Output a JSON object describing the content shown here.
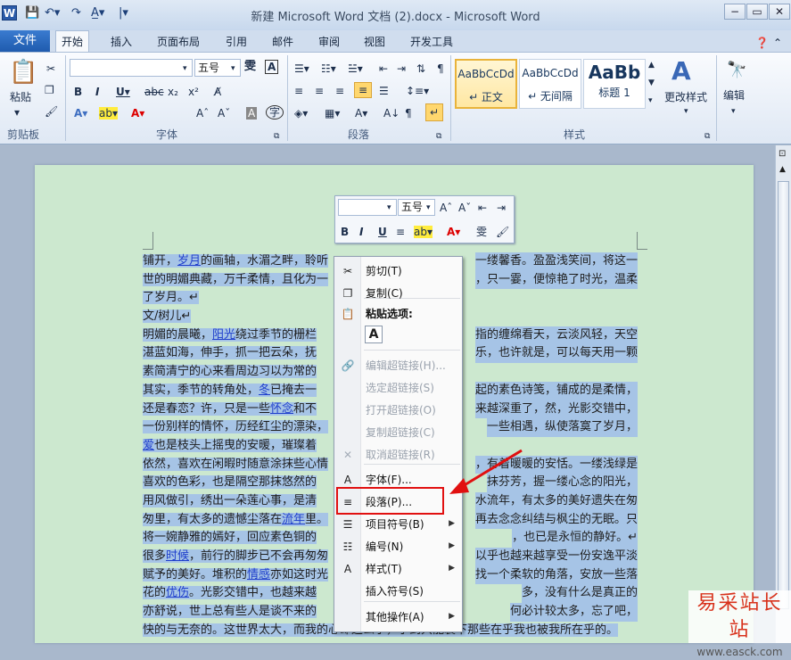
{
  "window": {
    "title": "新建 Microsoft Word 文档 (2).docx  -  Microsoft Word",
    "app_icon": "W",
    "controls": [
      "−",
      "▭",
      "✕"
    ]
  },
  "tabs": [
    "文件",
    "开始",
    "插入",
    "页面布局",
    "引用",
    "邮件",
    "审阅",
    "视图",
    "开发工具"
  ],
  "ribbon": {
    "clipboard": {
      "paste_label": "粘贴",
      "group": "剪贴板"
    },
    "font": {
      "name_value": "",
      "size_value": "五号",
      "group": "字体"
    },
    "paragraph": {
      "group": "段落"
    },
    "styles": {
      "group": "样式",
      "items": [
        {
          "preview": "AaBbCcDd",
          "name": "↵ 正文"
        },
        {
          "preview": "AaBbCcDd",
          "name": "↵ 无间隔"
        },
        {
          "preview": "AaBb",
          "name": "标题 1"
        }
      ],
      "change_label": "更改样式"
    },
    "editing": {
      "label": "编辑"
    }
  },
  "minitoolbar": {
    "font_value": "",
    "size_value": "五号"
  },
  "document": {
    "lines": [
      [
        "铺开，",
        {
          "link": "岁月"
        },
        "的画轴，水湄之畔，聆听"
      ],
      [
        "世的明媚典藏，万千柔情，且化为一"
      ],
      [
        "了岁月。↵"
      ],
      [
        "文/树儿↵"
      ],
      [
        "明媚的晨曦，",
        {
          "link": "阳光"
        },
        "绕过季节的栅栏"
      ],
      [
        "湛蓝如海，伸手，抓一把云朵，抚"
      ],
      [
        "素简清宁的心来看周边习以为常的"
      ],
      [
        "其实，季节的转角处，",
        {
          "link": "冬"
        },
        "已掩去一"
      ],
      [
        "还是春恋？许，只是一些",
        {
          "link": "怀念"
        },
        "和不"
      ],
      [
        "一份别样的情怀，历经红尘的漂染，"
      ],
      [
        {
          "link": "爱"
        },
        "也是枝头上摇曳的安暖，璀璨着"
      ],
      [
        "依然，喜欢在闲暇时随意涂抹些心情"
      ],
      [
        "喜欢的色彩，也是隔空那抹悠然的"
      ],
      [
        "用风做引，绣出一朵莲心事，是清"
      ],
      [
        "匆里，有太多的遗憾尘落在",
        {
          "link": "流年"
        },
        "里。"
      ],
      [
        "将一婉静雅的嫣好，回应素色铜的"
      ],
      [
        "很多",
        {
          "link": "时候"
        },
        "，前行的脚步已不会再匆匆"
      ],
      [
        "赋予的美好。堆积的",
        {
          "link": "情感"
        },
        "亦如这时光"
      ],
      [
        "花的",
        {
          "link": "优伤"
        },
        "。光影交错中，也越来越"
      ],
      [
        "亦舒说，世上总有些人是谈不来的"
      ],
      [
        "快的与无奈的。这世界太大，而我的心却这么小，小到只能装下那些在乎我也被我所在乎的。"
      ]
    ],
    "right_lines": [
      "一缕馨香。盈盈浅笑间，将这一",
      "，只一霎，便惊艳了时光，温柔",
      "",
      "",
      "指的缠绵看天，云淡风轻，天空",
      "乐，也许就是，可以每天用一颗",
      "",
      "起的素色诗笺，铺成的是柔情，",
      "来越深重了，然，光影交错中，",
      "一些相遇，纵使落寞了岁月，",
      "",
      "，有着暖暖的安恬。一缕浅绿是",
      "抹芬芳，握一缕心念的阳光，",
      "水流年，有太多的美好遗失在匆",
      "再去念念纠结与枫尘的无眠。只",
      "，也已是永恒的静好。↵",
      "以乎也越来越享受一份安逸平淡",
      "找一个柔软的角落，安放一些落",
      "多，没有什么是真正的",
      "何必计较太多，忘了吧，",
      ""
    ]
  },
  "context_menu": {
    "items": [
      {
        "icon": "scissors-icon",
        "glyph": "✂",
        "label": "剪切(T)",
        "enabled": true
      },
      {
        "icon": "copy-icon",
        "glyph": "❐",
        "label": "复制(C)",
        "enabled": true
      },
      {
        "icon": "paste-icon",
        "glyph": "📋",
        "label": "粘贴选项:",
        "enabled": true,
        "bold": true
      },
      {
        "icon": "keep-text-only-icon",
        "glyph": "A",
        "label": "",
        "enabled": true
      },
      {
        "icon": "edit-hyperlink-icon",
        "glyph": "🔗",
        "label": "编辑超链接(H)...",
        "enabled": false
      },
      {
        "icon": "",
        "glyph": "",
        "label": "选定超链接(S)",
        "enabled": false
      },
      {
        "icon": "",
        "glyph": "",
        "label": "打开超链接(O)",
        "enabled": false
      },
      {
        "icon": "",
        "glyph": "",
        "label": "复制超链接(C)",
        "enabled": false
      },
      {
        "icon": "remove-hyperlink-icon",
        "glyph": "✕",
        "label": "取消超链接(R)",
        "enabled": false
      },
      {
        "icon": "font-icon",
        "glyph": "A",
        "label": "字体(F)...",
        "enabled": true
      },
      {
        "icon": "paragraph-icon",
        "glyph": "≡",
        "label": "段落(P)...",
        "enabled": true
      },
      {
        "icon": "bullets-icon",
        "glyph": "☰",
        "label": "项目符号(B)",
        "enabled": true,
        "submenu": true
      },
      {
        "icon": "numbering-icon",
        "glyph": "☷",
        "label": "编号(N)",
        "enabled": true,
        "submenu": true
      },
      {
        "icon": "styles-icon",
        "glyph": "A",
        "label": "样式(T)",
        "enabled": true,
        "submenu": true
      },
      {
        "icon": "",
        "glyph": "",
        "label": "插入符号(S)",
        "enabled": true
      },
      {
        "icon": "",
        "glyph": "",
        "label": "其他操作(A)",
        "enabled": true,
        "submenu": true
      }
    ]
  },
  "watermark": {
    "brand": "易采站长站",
    "domain": "www.easck.com"
  }
}
